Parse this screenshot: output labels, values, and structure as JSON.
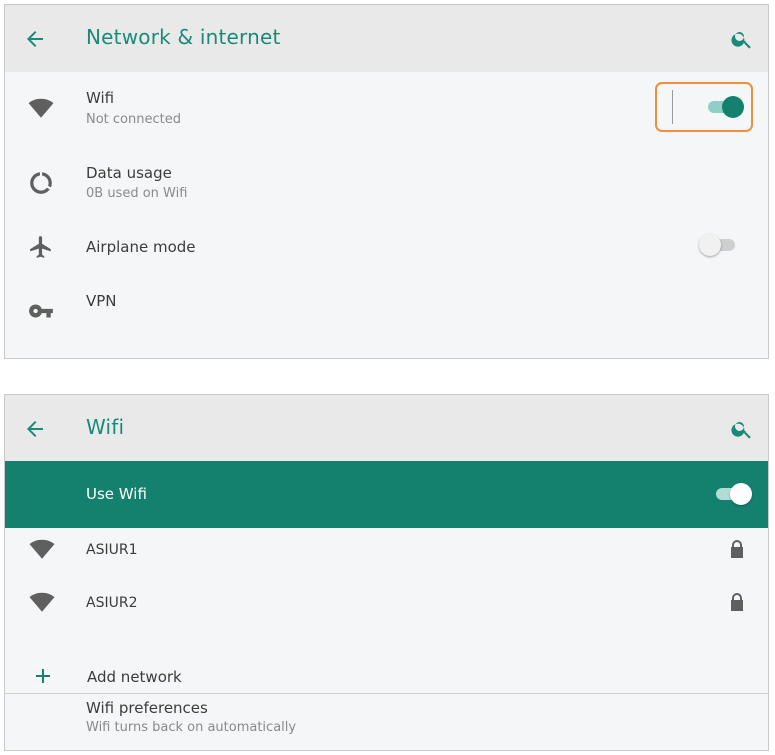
{
  "colors": {
    "accent": "#14806e",
    "title_text": "#1a8a78",
    "appbar_bg": "#e9e9ea",
    "highlight": "#ef8f3d"
  },
  "network_screen": {
    "title": "Network & internet",
    "back_icon": "arrow-back-icon",
    "search_icon": "search-icon",
    "items": [
      {
        "icon": "wifi-icon",
        "title": "Wifi",
        "subtitle": "Not connected",
        "toggle": "on"
      },
      {
        "icon": "data-usage-icon",
        "title": "Data usage",
        "subtitle": "0B used on Wifi"
      },
      {
        "icon": "airplane-icon",
        "title": "Airplane mode",
        "toggle": "off"
      },
      {
        "icon": "vpn-key-icon",
        "title": "VPN"
      }
    ]
  },
  "wifi_screen": {
    "title": "Wifi",
    "back_icon": "arrow-back-icon",
    "search_icon": "search-icon",
    "use_wifi": {
      "label": "Use Wifi",
      "toggle": "on"
    },
    "networks": [
      {
        "icon": "wifi-icon",
        "ssid": "ASIUR1",
        "secured_icon": "lock-icon"
      },
      {
        "icon": "wifi-icon",
        "ssid": "ASIUR2",
        "secured_icon": "lock-icon"
      }
    ],
    "add_network": {
      "icon": "plus-icon",
      "label": "Add network"
    },
    "preferences": {
      "title": "Wifi preferences",
      "subtitle": "Wifi turns back on automatically"
    }
  }
}
